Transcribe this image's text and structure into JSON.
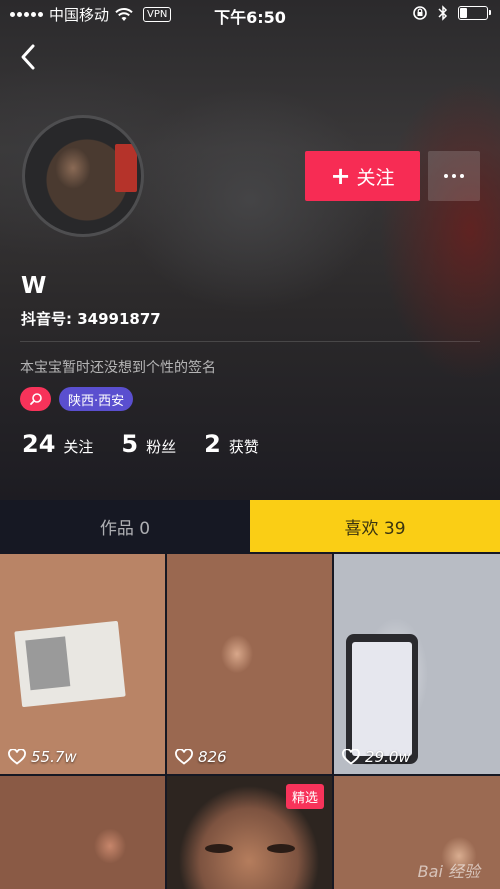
{
  "status_bar": {
    "carrier": "中国移动",
    "vpn": "VPN",
    "time": "下午6:50",
    "battery_level": 0.25
  },
  "profile": {
    "nickname": "W",
    "douyin_id": "抖音号: 34991877",
    "signature": "本宝宝暂时还没想到个性的签名",
    "location_tag": "陕西·西安",
    "follow_button": "关注",
    "follow_plus": "+"
  },
  "stats": [
    {
      "count": "24",
      "label": "关注"
    },
    {
      "count": "5",
      "label": "粉丝"
    },
    {
      "count": "2",
      "label": "获赞"
    }
  ],
  "tabs": {
    "works": "作品 0",
    "likes": "喜欢 39"
  },
  "videos": [
    {
      "likes": "55.7w",
      "badge": ""
    },
    {
      "likes": "826",
      "badge": ""
    },
    {
      "likes": "29.0w",
      "badge": ""
    },
    {
      "likes": "",
      "badge": ""
    },
    {
      "likes": "",
      "badge": "精选"
    },
    {
      "likes": "",
      "badge": ""
    }
  ],
  "watermark": "Bai 经验",
  "colors": {
    "accent": "#f72c54",
    "likes_tab": "#face15",
    "location_tag": "#5a4fcf",
    "background": "#161823"
  }
}
